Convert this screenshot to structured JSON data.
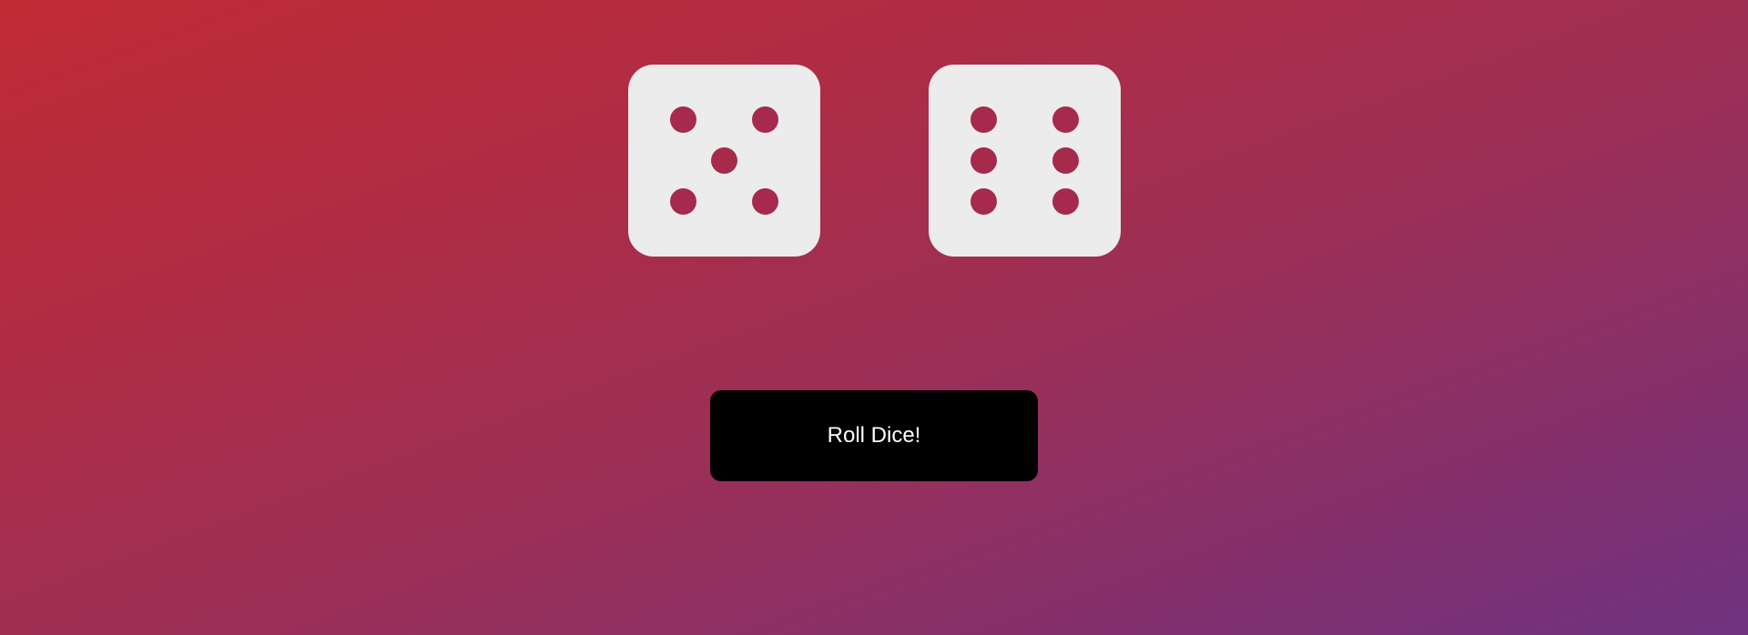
{
  "dice": [
    {
      "value": 5
    },
    {
      "value": 6
    }
  ],
  "roll_button": {
    "label": "Roll Dice!"
  },
  "colors": {
    "die_face": "#ececec",
    "pip": "#a52a4c",
    "button_bg": "#000000",
    "button_text": "#ffffff",
    "background_start": "#c12c34",
    "background_end": "#6f3280"
  }
}
